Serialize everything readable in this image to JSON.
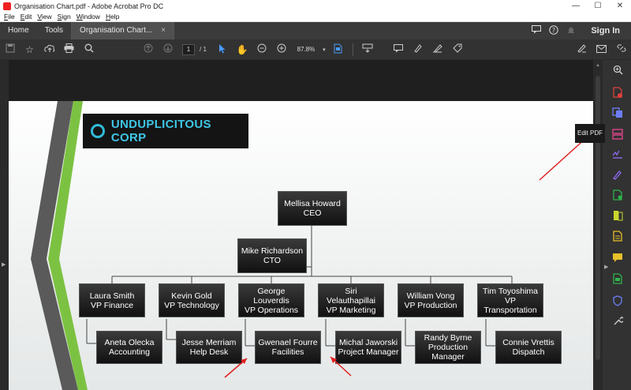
{
  "window": {
    "title": "Organisation Chart.pdf - Adobe Acrobat Pro DC",
    "minimize": "—",
    "maximize": "☐",
    "close": "✕"
  },
  "menu": [
    "File",
    "Edit",
    "View",
    "Sign",
    "Window",
    "Help"
  ],
  "tabs": {
    "home": "Home",
    "tools": "Tools",
    "document": "Organisation Chart...",
    "close": "×",
    "signin": "Sign In"
  },
  "toolbar": {
    "page_current": "1",
    "page_total": "/ 1",
    "zoom": "87.8%"
  },
  "tooltip": "Edit PDF",
  "document": {
    "company": "UNDUPLICITOUS CORP",
    "nodes": {
      "ceo": "Mellisa Howard\nCEO",
      "cto": "Mike Richardson\nCTO",
      "vp_finance": "Laura Smith\nVP Finance",
      "vp_tech": "Kevin Gold\nVP Technology",
      "vp_ops": "George\nLouverdis\nVP Operations",
      "vp_marketing": "Siri\nVelauthapillai\nVP Marketing",
      "vp_production": "William Vong\nVP Production",
      "vp_transport": "Tim Toyoshima\nVP\nTransportation",
      "accounting": "Aneta Olecka\nAccounting",
      "helpdesk": "Jesse Merriam\nHelp Desk",
      "facilities": "Gwenael Fourre\nFacilities",
      "pm": "Michal Jaworski\nProject Manager",
      "production_mgr": "Randy Byrne\nProduction\nManager",
      "dispatch": "Connie Vrettis\nDispatch"
    }
  },
  "colors": {
    "accent": "#3ec6e6",
    "stripe_green": "#7cc242",
    "stripe_gray": "#5a5a5a",
    "arrow_red": "#e02020"
  }
}
